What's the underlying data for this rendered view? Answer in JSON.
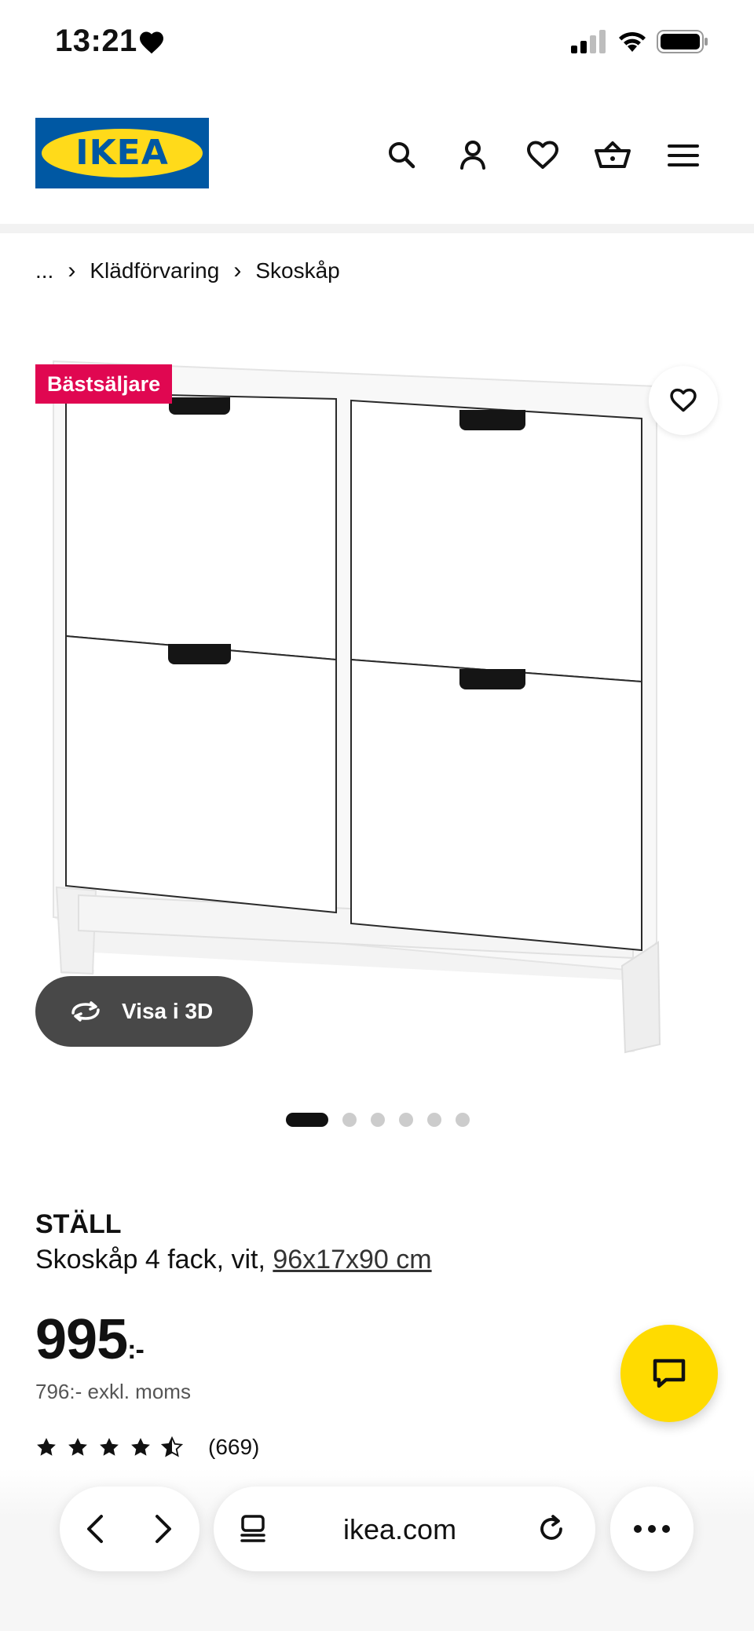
{
  "status_bar": {
    "time": "13:21"
  },
  "header": {
    "logo_text": "IKEA"
  },
  "breadcrumb": {
    "ellipsis": "...",
    "items": [
      "Klädförvaring",
      "Skoskåp"
    ]
  },
  "gallery": {
    "badge": "Bästsäljare",
    "view_3d_label": "Visa i 3D",
    "dots_total": 6,
    "dots_active": 1
  },
  "product": {
    "name": "STÄLL",
    "description": "Skoskåp 4 fack, vit, ",
    "dimensions": "96x17x90 cm",
    "price": "995",
    "price_suffix": ":-",
    "price_ex_vat": "796:- exkl. moms",
    "rating_stars": 4.5,
    "review_count": "(669)"
  },
  "browser": {
    "url": "ikea.com"
  },
  "colors": {
    "brand_blue": "#0058a3",
    "brand_yellow": "#ffda1a",
    "badge_red": "#e00751",
    "chat_yellow": "#ffdb00"
  }
}
